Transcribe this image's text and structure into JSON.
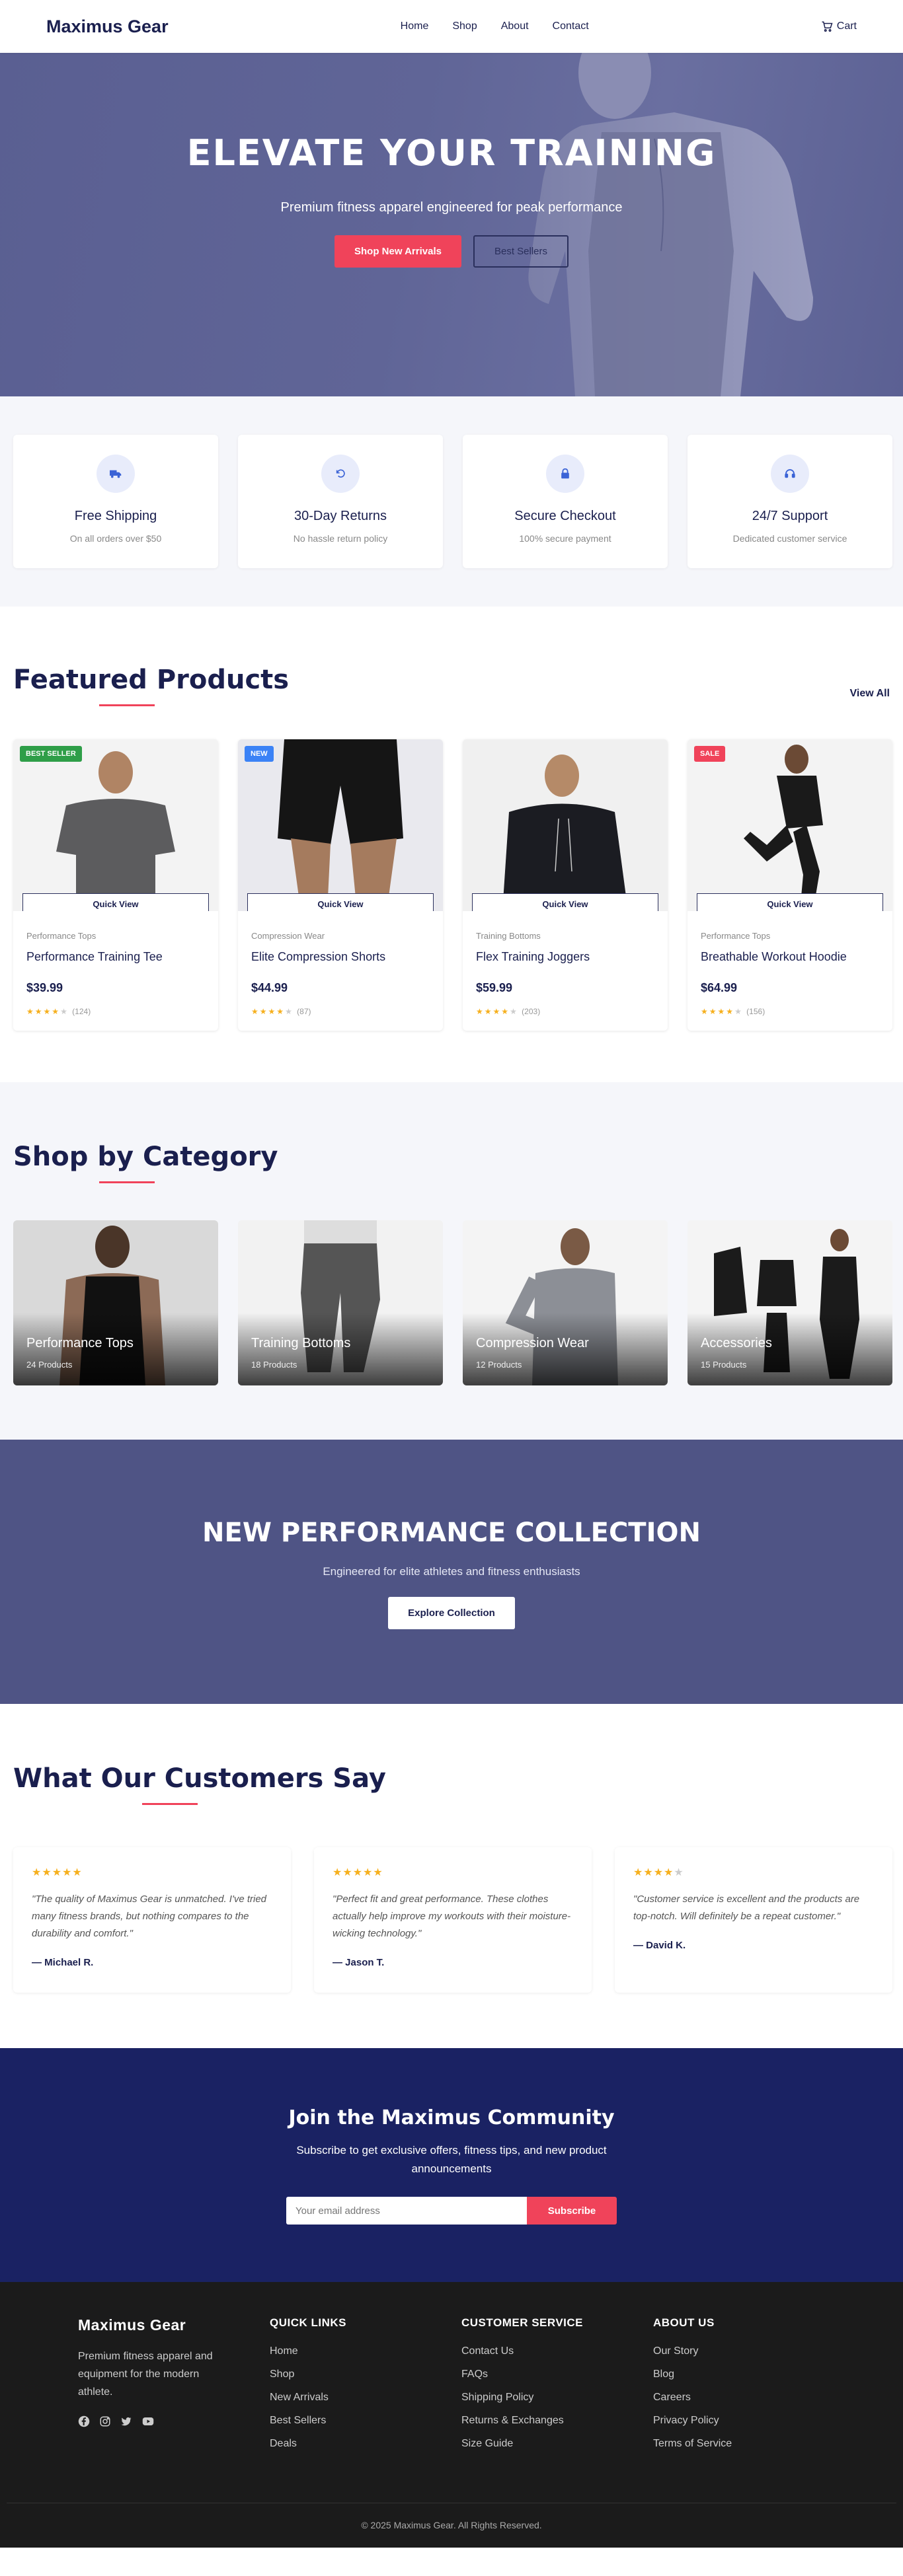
{
  "header": {
    "logo": "Maximus Gear",
    "nav": [
      "Home",
      "Shop",
      "About",
      "Contact"
    ],
    "cart_label": "Cart"
  },
  "hero": {
    "title": "ELEVATE YOUR TRAINING",
    "subtitle": "Premium fitness apparel engineered for peak performance",
    "primary_button": "Shop New Arrivals",
    "secondary_button": "Best Sellers"
  },
  "features": [
    {
      "icon": "truck-icon",
      "title": "Free Shipping",
      "text": "On all orders over $50"
    },
    {
      "icon": "return-icon",
      "title": "30-Day Returns",
      "text": "No hassle return policy"
    },
    {
      "icon": "lock-icon",
      "title": "Secure Checkout",
      "text": "100% secure payment"
    },
    {
      "icon": "headset-icon",
      "title": "24/7 Support",
      "text": "Dedicated customer service"
    }
  ],
  "featured": {
    "title": "Featured Products",
    "view_all": "View All",
    "quick_view": "Quick View",
    "products": [
      {
        "badge": "BEST SELLER",
        "badge_color": "#2e9e48",
        "category": "Performance Tops",
        "name": "Performance Training Tee",
        "price": "$39.99",
        "rating": 4,
        "reviews": "(124)"
      },
      {
        "badge": "NEW",
        "badge_color": "#3b82f6",
        "category": "Compression Wear",
        "name": "Elite Compression Shorts",
        "price": "$44.99",
        "rating": 4,
        "reviews": "(87)"
      },
      {
        "badge": "",
        "badge_color": "",
        "category": "Training Bottoms",
        "name": "Flex Training Joggers",
        "price": "$59.99",
        "rating": 4,
        "reviews": "(203)"
      },
      {
        "badge": "SALE",
        "badge_color": "#f0435a",
        "category": "Performance Tops",
        "name": "Breathable Workout Hoodie",
        "price": "$64.99",
        "rating": 4,
        "reviews": "(156)"
      }
    ]
  },
  "categories": {
    "title": "Shop by Category",
    "items": [
      {
        "name": "Performance Tops",
        "count": "24 Products"
      },
      {
        "name": "Training Bottoms",
        "count": "18 Products"
      },
      {
        "name": "Compression Wear",
        "count": "12 Products"
      },
      {
        "name": "Accessories",
        "count": "15 Products"
      }
    ]
  },
  "collection": {
    "title": "NEW PERFORMANCE COLLECTION",
    "subtitle": "Engineered for elite athletes and fitness enthusiasts",
    "button": "Explore Collection"
  },
  "testimonials": {
    "title": "What Our Customers Say",
    "items": [
      {
        "stars": 5,
        "quote": "\"The quality of Maximus Gear is unmatched. I've tried many fitness brands, but nothing compares to the durability and comfort.\"",
        "author": "— Michael R."
      },
      {
        "stars": 5,
        "quote": "\"Perfect fit and great performance. These clothes actually help improve my workouts with their moisture-wicking technology.\"",
        "author": "— Jason T."
      },
      {
        "stars": 4,
        "quote": "\"Customer service is excellent and the products are top-notch. Will definitely be a repeat customer.\"",
        "author": "— David K."
      }
    ]
  },
  "newsletter": {
    "title": "Join the Maximus Community",
    "text": "Subscribe to get exclusive offers, fitness tips, and new product announcements",
    "placeholder": "Your email address",
    "button": "Subscribe"
  },
  "footer": {
    "brand": "Maximus Gear",
    "about_text": "Premium fitness apparel and equipment for the modern athlete.",
    "social": [
      "facebook-icon",
      "instagram-icon",
      "twitter-icon",
      "youtube-icon"
    ],
    "columns": [
      {
        "title": "QUICK LINKS",
        "links": [
          "Home",
          "Shop",
          "New Arrivals",
          "Best Sellers",
          "Deals"
        ]
      },
      {
        "title": "CUSTOMER SERVICE",
        "links": [
          "Contact Us",
          "FAQs",
          "Shipping Policy",
          "Returns & Exchanges",
          "Size Guide"
        ]
      },
      {
        "title": "ABOUT US",
        "links": [
          "Our Story",
          "Blog",
          "Careers",
          "Privacy Policy",
          "Terms of Service"
        ]
      }
    ],
    "copyright": "© 2025 Maximus Gear. All Rights Reserved."
  },
  "colors": {
    "accent": "#f0435a",
    "navy": "#1a1f4e",
    "hero": "#5a5f92",
    "newsletter": "#1a2263",
    "footer": "#1b1b1b"
  }
}
